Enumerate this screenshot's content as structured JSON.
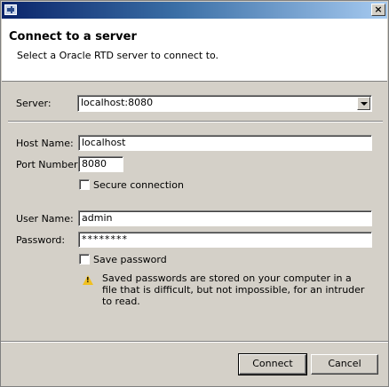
{
  "window": {
    "icon": "app-icon",
    "close_label": "×"
  },
  "header": {
    "title": "Connect to a server",
    "description": "Select a Oracle RTD server to connect to."
  },
  "server": {
    "label": "Server:",
    "value": "localhost:8080"
  },
  "host": {
    "label": "Host Name:",
    "value": "localhost"
  },
  "port": {
    "label": "Port Number:",
    "value": "8080"
  },
  "secure": {
    "label": "Secure connection",
    "checked": false
  },
  "user": {
    "label": "User Name:",
    "value": "admin"
  },
  "password": {
    "label": "Password:",
    "value": "********"
  },
  "save_password": {
    "label": "Save password",
    "checked": false
  },
  "warning": {
    "icon": "warning-icon",
    "text": "Saved passwords are stored on your computer in a file that is difficult, but not impossible, for an intruder to read."
  },
  "buttons": {
    "connect": "Connect",
    "cancel": "Cancel"
  }
}
